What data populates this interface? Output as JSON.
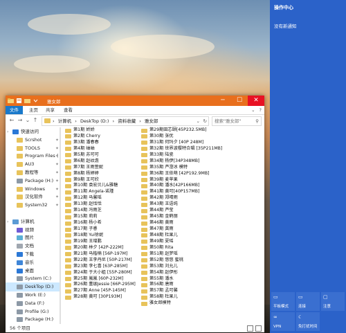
{
  "window": {
    "title": "雅女郎",
    "controls": {
      "minimize": "─",
      "maximize": "☐",
      "close": "✕"
    }
  },
  "ribbon": {
    "tabs": [
      "文件",
      "主页",
      "共享",
      "查看"
    ]
  },
  "address": {
    "crumbs": [
      "›",
      "计算机",
      "›",
      "DeskTop (D:)",
      "›",
      "资料收藏",
      "›",
      "雅女郎"
    ],
    "search_placeholder": "搜索\"雅女郎\""
  },
  "nav": [
    {
      "label": "快速访问",
      "icon": "star",
      "type": "header"
    },
    {
      "label": "Scrshot",
      "icon": "folder",
      "pin": true
    },
    {
      "label": "TOOLS",
      "icon": "folder",
      "pin": true
    },
    {
      "label": "Program Files (",
      "icon": "folder",
      "pin": true
    },
    {
      "label": "AU3",
      "icon": "folder",
      "pin": true
    },
    {
      "label": "教程等",
      "icon": "folder",
      "pin": true
    },
    {
      "label": "Package (H:)",
      "icon": "drive",
      "pin": true
    },
    {
      "label": "Windows",
      "icon": "folder",
      "pin": true
    },
    {
      "label": "汉化软件",
      "icon": "folder",
      "pin": true
    },
    {
      "label": "System32",
      "icon": "folder",
      "pin": true
    },
    {
      "label": "",
      "icon": "none"
    },
    {
      "label": "计算机",
      "icon": "computer",
      "type": "header"
    },
    {
      "label": "视频",
      "icon": "video"
    },
    {
      "label": "图片",
      "icon": "picture"
    },
    {
      "label": "文档",
      "icon": "document"
    },
    {
      "label": "下载",
      "icon": "download"
    },
    {
      "label": "音乐",
      "icon": "music"
    },
    {
      "label": "桌面",
      "icon": "desktop"
    },
    {
      "label": "System (C:)",
      "icon": "drive"
    },
    {
      "label": "DeskTop (D:)",
      "icon": "drive",
      "selected": true
    },
    {
      "label": "Work (E:)",
      "icon": "drive"
    },
    {
      "label": "Data (F:)",
      "icon": "drive"
    },
    {
      "label": "Profile (G:)",
      "icon": "drive"
    },
    {
      "label": "Package (H:)",
      "icon": "drive"
    }
  ],
  "files_col1": [
    "第1期 娇娇",
    "第2期 Cherry",
    "第3期 潘春春",
    "第4期 岫岫",
    "第5期 苏可可",
    "第6期 赵纹澹",
    "第7期 王雨萱妮",
    "第8期 杨婷婷",
    "第9期 王可欣",
    "第10期 袁宏贝儿&雅糖",
    "第11期 Angela-诺瑾",
    "第12期 马馨瑶",
    "第13期 赵恬恬",
    "第14期 冯雨芝",
    "第15期 莉莉",
    "第16期 杨小希",
    "第17期 子睿",
    "第18期 Yui徐妮",
    "第19期 王增鹏",
    "第20期 林夕 [42P-222M]",
    "第21期 马楷楠 [56P-197M]",
    "第22期 王李丹尼 [50P-217M]",
    "第23期 李七喜 [63P-285M]",
    "第24期 于大小姐 [55P-280M]",
    "第25期 嵐嵐 [60P-232M]",
    "第26期 董珈Jessie [66P-295M]",
    "第27期 Anne [45P-145M]",
    "第28期 黄可 [30P193M]"
  ],
  "files_col2": [
    "第29期田芯颐[45P232.5MB]",
    "第30期 张优",
    "第31期 何玛夕 [40P 248M]",
    "第32期 世界波樱特合辑 [35P211MB]",
    "第33期 陆瓷",
    "第34期 杨伊[34P348MB]",
    "第35期 芦澄冰 模特",
    "第36期 王依萌 [42P192.9MB]",
    "第39期 麦苹果",
    "第40期 潘水[42P166MB]",
    "第41期 黄可[40P157MB]",
    "第42期 郑晴雨",
    "第43期 王语纯",
    "第44期 芦莹",
    "第45期 金鹤丽",
    "第46期 黄雨",
    "第47期 龚雨",
    "第48期 杜果儿",
    "第49期 夏瑶",
    "第50期 Rita",
    "第51期 赵梦瑶",
    "第52期 悠悠 蜜桃",
    "第53期 刘允儿",
    "第54期 赵伊彤",
    "第55期 潘水",
    "第56期 唐雨",
    "第57期 孟可馨",
    "第58期 杜果儿",
    "雅女郎模特"
  ],
  "status": {
    "count": "56 个项目"
  },
  "action_center": {
    "title": "操作中心",
    "message": "没有新通知",
    "tiles": [
      {
        "label": "平板模式",
        "icon": "▭"
      },
      {
        "label": "连接",
        "icon": "▭"
      },
      {
        "label": "注意",
        "icon": "▢"
      },
      {
        "label": "VPN",
        "icon": "∞"
      },
      {
        "label": "免打扰时间",
        "icon": "☾"
      }
    ]
  }
}
